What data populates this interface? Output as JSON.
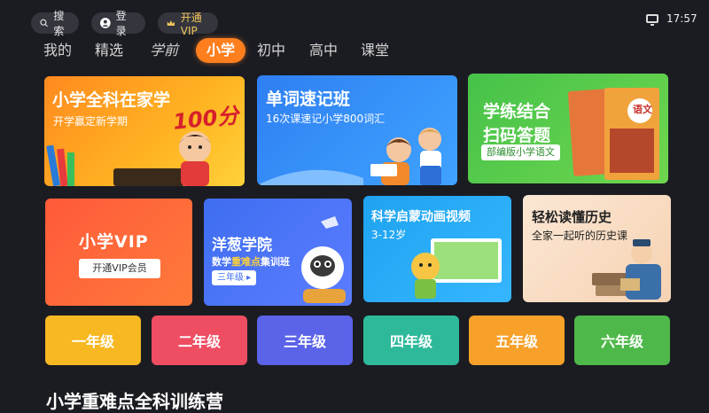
{
  "status": {
    "time": "17:57"
  },
  "topbar": {
    "search_label": "搜索",
    "login_label": "登录",
    "vip_label": "开通VIP"
  },
  "tabs": [
    {
      "label": "我的"
    },
    {
      "label": "精选"
    },
    {
      "label": "学前"
    },
    {
      "label": "小学",
      "active": true
    },
    {
      "label": "初中"
    },
    {
      "label": "高中"
    },
    {
      "label": "课堂"
    }
  ],
  "cards": {
    "home_study": {
      "title": "小学全科在家学",
      "subtitle": "开学赢定新学期",
      "badge": "100分"
    },
    "word_memory": {
      "title": "单词速记班",
      "subtitle": "16次课速记小学800词汇"
    },
    "practice": {
      "title_line1": "学练结合",
      "title_line2": "扫码答题",
      "tag": "部编版小学语文",
      "book_label": "语文"
    },
    "vip": {
      "title": "小学VIP",
      "button": "开通VIP会员"
    },
    "onion": {
      "title": "洋葱学院",
      "subtitle_pre": "数学",
      "subtitle_highlight": "重难点",
      "subtitle_post": "集训班",
      "grade_button": "三年级"
    },
    "science": {
      "title": "科学启蒙动画视频",
      "subtitle": "3-12岁"
    },
    "history": {
      "title": "轻松读懂历史",
      "subtitle": "全家一起听的历史课"
    }
  },
  "grades": [
    {
      "label": "一年级",
      "color": "#f7b822"
    },
    {
      "label": "二年级",
      "color": "#ee4d62"
    },
    {
      "label": "三年级",
      "color": "#5b63e8"
    },
    {
      "label": "四年级",
      "color": "#2fb99b"
    },
    {
      "label": "五年级",
      "color": "#f7a02a"
    },
    {
      "label": "六年级",
      "color": "#4fb84a"
    }
  ],
  "section": {
    "title": "小学重难点全科训练营"
  },
  "colors": {
    "accent": "#ff7f1f",
    "background": "#1b1c22"
  }
}
